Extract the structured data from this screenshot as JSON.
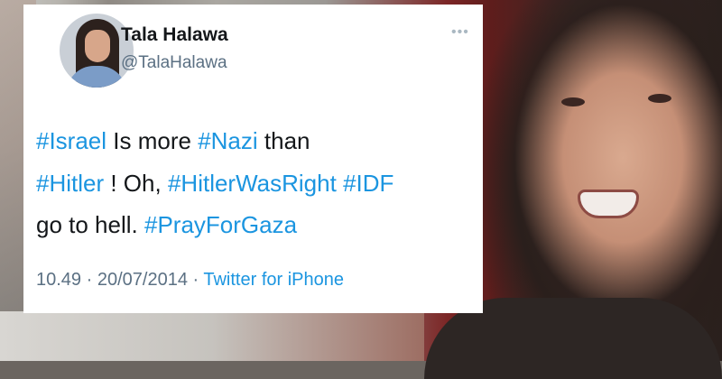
{
  "tweet": {
    "display_name": "Tala Halawa",
    "handle": "@TalaHalawa",
    "more_icon": "more-dots-icon",
    "text": {
      "line1": [
        {
          "t": "#Israel",
          "tag": true
        },
        {
          "t": " Is more ",
          "tag": false
        },
        {
          "t": "#Nazi",
          "tag": true
        },
        {
          "t": " than",
          "tag": false
        }
      ],
      "line2": [
        {
          "t": "#Hitler",
          "tag": true
        },
        {
          "t": " ! Oh, ",
          "tag": false
        },
        {
          "t": "#HitlerWasRight",
          "tag": true
        },
        {
          "t": " ",
          "tag": false
        },
        {
          "t": "#IDF",
          "tag": true
        }
      ],
      "line3": [
        {
          "t": "go to hell. ",
          "tag": false
        },
        {
          "t": "#PrayForGaza",
          "tag": true
        }
      ]
    },
    "time": "10.49",
    "separator": " · ",
    "date": "20/07/2014",
    "source": "Twitter for iPhone"
  },
  "colors": {
    "hashtag": "#1b95e0",
    "text": "#14171a",
    "muted": "#5b7083",
    "card": "#ffffff"
  }
}
